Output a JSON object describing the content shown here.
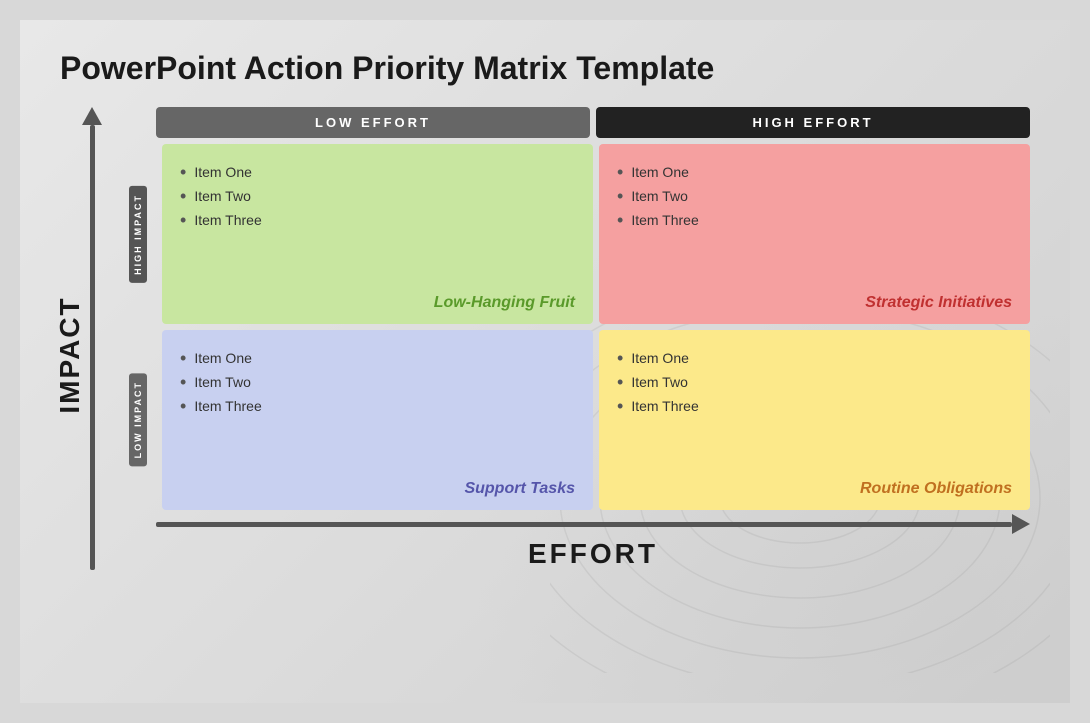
{
  "title": "PowerPoint Action Priority Matrix Template",
  "yAxisLabel": "IMPACT",
  "xAxisLabel": "EFFORT",
  "columns": [
    {
      "id": "low-effort",
      "label": "LOW EFFORT",
      "style": "low"
    },
    {
      "id": "high-effort",
      "label": "HIGH EFFORT",
      "style": "high"
    }
  ],
  "rows": [
    {
      "id": "high-impact",
      "label": "HIGH IMPACT",
      "quadrants": [
        {
          "id": "low-hanging-fruit",
          "color": "green",
          "items": [
            "Item One",
            "Item Two",
            "Item Three"
          ],
          "quadrantLabel": "Low-Hanging Fruit"
        },
        {
          "id": "strategic-initiatives",
          "color": "red",
          "items": [
            "Item One",
            "Item Two",
            "Item Three"
          ],
          "quadrantLabel": "Strategic Initiatives"
        }
      ]
    },
    {
      "id": "low-impact",
      "label": "LOW IMPACT",
      "quadrants": [
        {
          "id": "support-tasks",
          "color": "blue",
          "items": [
            "Item One",
            "Item Two",
            "Item Three"
          ],
          "quadrantLabel": "Support Tasks"
        },
        {
          "id": "routine-obligations",
          "color": "yellow",
          "items": [
            "Item One",
            "Item Two",
            "Item Three"
          ],
          "quadrantLabel": "Routine Obligations"
        }
      ]
    }
  ]
}
